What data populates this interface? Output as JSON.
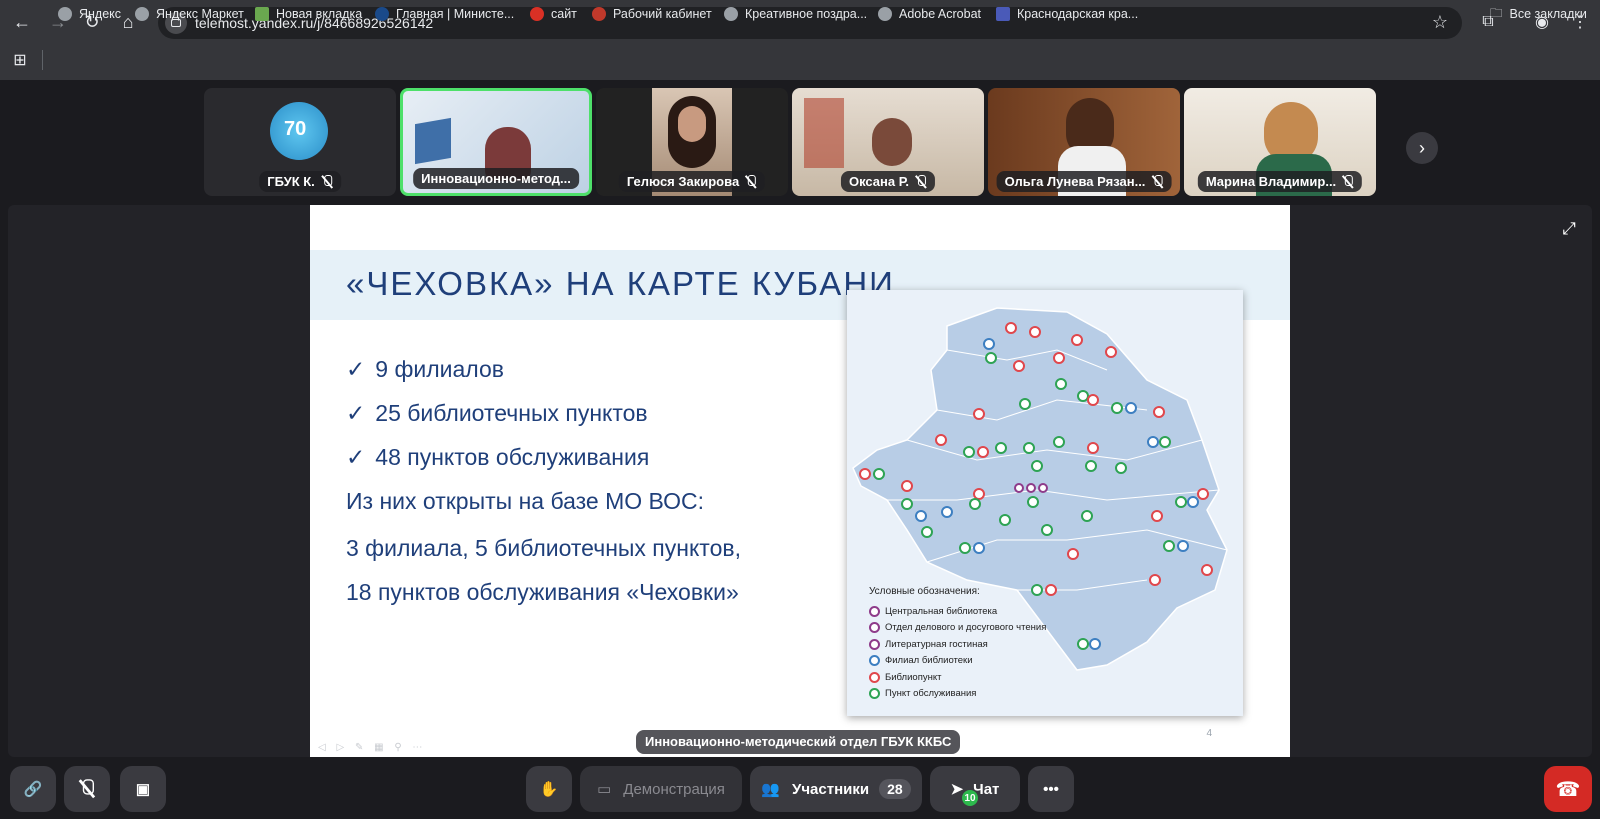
{
  "browser": {
    "url": "telemost.yandex.ru/j/84668926526142",
    "bookmarks": [
      {
        "label": "Яндекс",
        "color": "#9aa0a6"
      },
      {
        "label": "Яндекс Маркет",
        "color": "#9aa0a6"
      },
      {
        "label": "Новая вкладка",
        "color": "#6aa84f"
      },
      {
        "label": "Главная | Министе...",
        "color": "#1a4a8a"
      },
      {
        "label": "сайт",
        "color": "#d93025"
      },
      {
        "label": "Рабочий кабинет",
        "color": "#c0392b"
      },
      {
        "label": "Креативное поздра...",
        "color": "#9aa0a6"
      },
      {
        "label": "Adobe Acrobat",
        "color": "#9aa0a6"
      },
      {
        "label": "Краснодарская кра...",
        "color": "#4a5ab8"
      }
    ],
    "all_bookmarks": "Все закладки"
  },
  "participants": [
    {
      "name": "ГБУК К.",
      "muted": true,
      "active": false
    },
    {
      "name": "Инновационно-метод...",
      "muted": false,
      "active": true
    },
    {
      "name": "Гелюся Закирова",
      "muted": true,
      "active": false
    },
    {
      "name": "Оксана Р.",
      "muted": true,
      "active": false
    },
    {
      "name": "Ольга Лунева Рязан...",
      "muted": true,
      "active": false
    },
    {
      "name": "Марина Владимир...",
      "muted": true,
      "active": false
    }
  ],
  "slide": {
    "title": "«ЧЕХОВКА» НА КАРТЕ КУБАНИ",
    "check": "✓",
    "bullets": [
      "9 филиалов",
      "25 библиотечных пунктов",
      "48 пунктов обслуживания"
    ],
    "para1": "Из них открыты на базе МО ВОС:",
    "para2": "3 филиала, 5 библиотечных пунктов,",
    "para3": "18 пунктов обслуживания «Чеховки»",
    "page": "4",
    "map_legend_title": "Условные обозначения:",
    "map_legend": [
      {
        "label": "Центральная библиотека",
        "color": "#8e3b8a"
      },
      {
        "label": "Отдел делового и досугового чтения",
        "color": "#8e3b8a"
      },
      {
        "label": "Литературная гостиная",
        "color": "#8e3b8a"
      },
      {
        "label": "Филиал библиотеки",
        "color": "#3d7fc1"
      },
      {
        "label": "Библиопункт",
        "color": "#e0474c"
      },
      {
        "label": "Пункт обслуживания",
        "color": "#2ea354"
      }
    ]
  },
  "speaker": "Инновационно-методический отдел ГБУК ККБС",
  "toolbar": {
    "demo": "Демонстрация",
    "participants": "Участники",
    "participants_count": "28",
    "chat": "Чат",
    "chat_badge": "10"
  }
}
